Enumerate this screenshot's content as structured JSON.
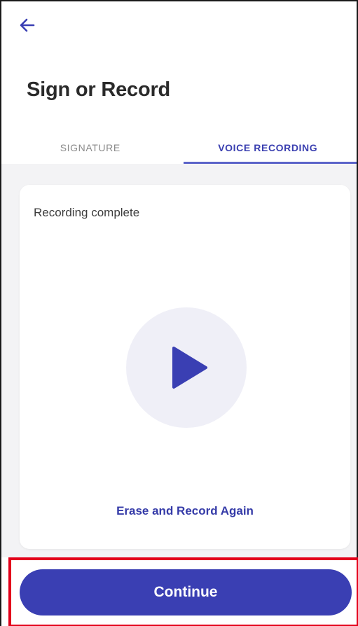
{
  "header": {
    "back_icon": "arrow-left-icon",
    "title": "Sign or Record"
  },
  "tabs": [
    {
      "label": "SIGNATURE",
      "active": false
    },
    {
      "label": "VOICE RECORDING",
      "active": true
    }
  ],
  "card": {
    "status": "Recording complete",
    "play_icon": "play-icon",
    "erase_label": "Erase and Record Again"
  },
  "footer": {
    "continue_label": "Continue"
  },
  "colors": {
    "accent": "#3a3fb3",
    "highlight": "#e3001b",
    "play_bg": "#efeff7",
    "content_bg": "#f3f3f5"
  }
}
